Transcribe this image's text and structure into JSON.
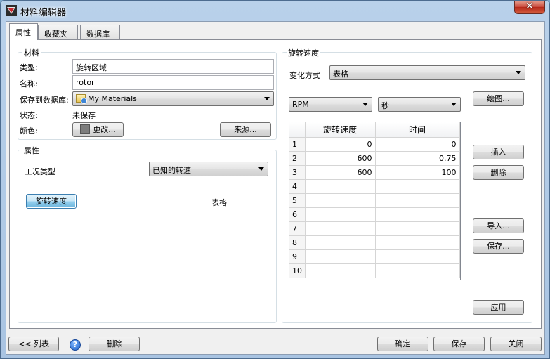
{
  "window": {
    "title": "材料编辑器",
    "close_glyph": "✕"
  },
  "tabs": [
    {
      "label": "属性"
    },
    {
      "label": "收藏夹"
    },
    {
      "label": "数据库"
    }
  ],
  "material": {
    "group_title": "材料",
    "type_label": "类型:",
    "type_value": "旋转区域",
    "name_label": "名称:",
    "name_value": "rotor",
    "save_db_label": "保存到数据库:",
    "save_db_value": "My Materials",
    "status_label": "状态:",
    "status_value": "未保存",
    "color_label": "颜色:",
    "color_button": "更改...",
    "source_button": "来源..."
  },
  "properties": {
    "group_title": "属性",
    "condition_label": "工况类型",
    "condition_value": "已知的转速",
    "speed_button": "旋转速度",
    "speed_value": "表格"
  },
  "rotation": {
    "group_title": "旋转速度",
    "mode_label": "变化方式",
    "mode_value": "表格",
    "unit_speed": "RPM",
    "unit_time": "秒",
    "plot_button": "绘图...",
    "insert_button": "插入",
    "delete_button": "删除",
    "import_button": "导入...",
    "save_button": "保存...",
    "apply_button": "应用",
    "columns": [
      "旋转速度",
      "时间"
    ],
    "rows": [
      {
        "n": "1",
        "speed": "0",
        "time": "0"
      },
      {
        "n": "2",
        "speed": "600",
        "time": "0.75"
      },
      {
        "n": "3",
        "speed": "600",
        "time": "100"
      },
      {
        "n": "4",
        "speed": "",
        "time": ""
      },
      {
        "n": "5",
        "speed": "",
        "time": ""
      },
      {
        "n": "6",
        "speed": "",
        "time": ""
      },
      {
        "n": "7",
        "speed": "",
        "time": ""
      },
      {
        "n": "8",
        "speed": "",
        "time": ""
      },
      {
        "n": "9",
        "speed": "",
        "time": ""
      },
      {
        "n": "10",
        "speed": "",
        "time": ""
      }
    ]
  },
  "footer": {
    "list_button": "<< 列表",
    "help_glyph": "?",
    "delete_button": "删除",
    "ok_button": "确定",
    "save_button": "保存",
    "close_button": "关闭"
  }
}
